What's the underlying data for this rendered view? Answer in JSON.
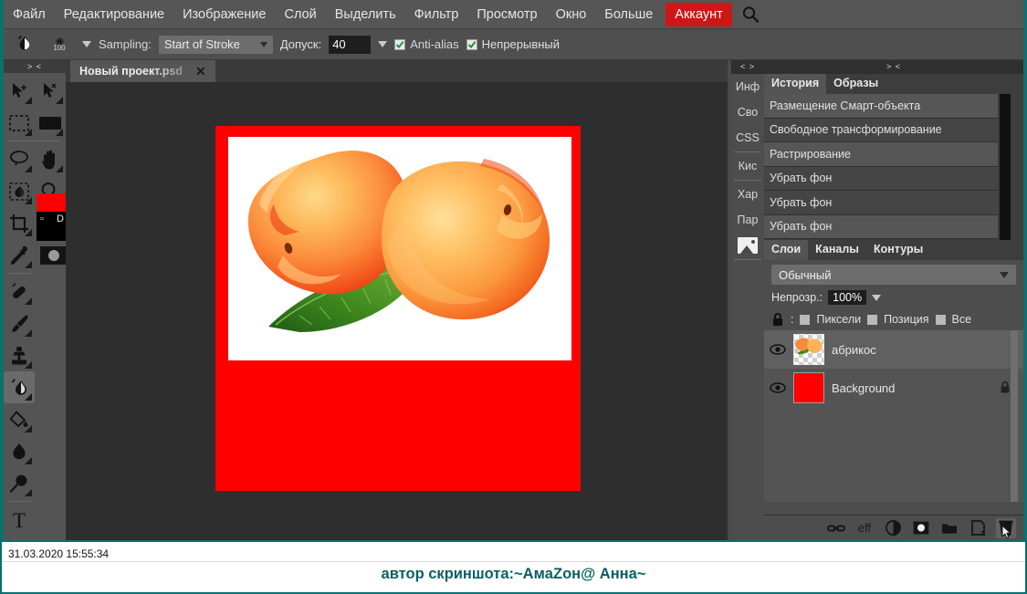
{
  "app": {
    "accent_red": "#cf1717",
    "teal": "#0e6f6f",
    "canvas_red": "#ff0000"
  },
  "menubar": {
    "items": [
      {
        "label": "Файл"
      },
      {
        "label": "Редактирование"
      },
      {
        "label": "Изображение"
      },
      {
        "label": "Слой"
      },
      {
        "label": "Выделить"
      },
      {
        "label": "Фильтр"
      },
      {
        "label": "Просмотр"
      },
      {
        "label": "Окно"
      },
      {
        "label": "Больше"
      }
    ],
    "account_label": "Аккаунт",
    "search_icon": "search-icon"
  },
  "options_bar": {
    "brush_size": "100",
    "sampling_label": "Sampling:",
    "sampling_value": "Start of Stroke",
    "tolerance_label": "Допуск:",
    "tolerance_value": "40",
    "antialias_label": "Anti-alias",
    "antialias_checked": true,
    "contiguous_label": "Непрерывный",
    "contiguous_checked": true
  },
  "toolbar": {
    "grip": "> <",
    "tools": [
      {
        "name": "move-tool",
        "icon": "arrow-move-icon"
      },
      {
        "name": "path-selection-tool",
        "icon": "arrow-path-icon"
      },
      {
        "name": "rectangular-marquee-tool",
        "icon": "marquee-icon"
      },
      {
        "name": "rectangle-shape-tool",
        "icon": "filled-rectangle-icon"
      },
      {
        "name": "lasso-tool",
        "icon": "lasso-icon"
      },
      {
        "name": "hand-tool",
        "icon": "hand-icon"
      },
      {
        "name": "object-select-tool",
        "icon": "object-select-icon"
      },
      {
        "name": "zoom-tool",
        "icon": "magnifier-icon"
      },
      {
        "name": "crop-tool",
        "icon": "crop-icon"
      },
      {
        "name": "eyedropper-tool",
        "icon": "eyedropper-icon"
      },
      {
        "name": "healing-brush-tool",
        "icon": "healing-brush-icon"
      },
      {
        "name": "brush-tool",
        "icon": "brush-icon"
      },
      {
        "name": "clone-stamp-tool",
        "icon": "stamp-icon"
      },
      {
        "name": "background-eraser-tool",
        "icon": "background-eraser-icon"
      },
      {
        "name": "paint-bucket-tool",
        "icon": "paint-bucket-icon"
      },
      {
        "name": "blur-tool",
        "icon": "water-drop-icon"
      },
      {
        "name": "dodge-tool",
        "icon": "dodge-icon"
      },
      {
        "name": "type-tool",
        "icon": "type-t-icon"
      },
      {
        "name": "pen-tool",
        "icon": "pen-icon"
      }
    ],
    "foreground_color": "#ff0000",
    "background_color": "#000000",
    "default_colors_label": "D",
    "quickmask_icon": "quick-mask-icon"
  },
  "document": {
    "tab_title": "Новый проект.psd",
    "close_label": "✕"
  },
  "canvas": {
    "background_color": "#ff0000",
    "photo_background": "#ffffff",
    "content_description": "апельсины-абрикосы",
    "brush_cursor": "brush-cursor"
  },
  "rail": {
    "grip": "< >",
    "items": [
      {
        "label": "Инф",
        "name": "rail-tab-info"
      },
      {
        "label": "Сво",
        "name": "rail-tab-properties"
      },
      {
        "label": "CSS",
        "name": "rail-tab-css"
      },
      {
        "label": "Кис",
        "name": "rail-tab-brushes"
      },
      {
        "label": "Хар",
        "name": "rail-tab-character"
      },
      {
        "label": "Пар",
        "name": "rail-tab-paragraph"
      }
    ],
    "image_icon_name": "image-thumbnail-icon"
  },
  "history_panel": {
    "grip": "> <",
    "tabs": [
      {
        "label": "История",
        "active": true
      },
      {
        "label": "Образы",
        "active": false
      }
    ],
    "items": [
      {
        "label": "Размещение Смарт-объекта",
        "state": "sel"
      },
      {
        "label": "Свободное трансформирование",
        "state": "alt"
      },
      {
        "label": "Растрирование",
        "state": "sel"
      },
      {
        "label": "Убрать фон",
        "state": "alt"
      },
      {
        "label": "Убрать фон",
        "state": "alt"
      },
      {
        "label": "Убрать фон",
        "state": "sel"
      }
    ]
  },
  "layers_panel": {
    "tabs": [
      {
        "label": "Слои",
        "active": true
      },
      {
        "label": "Каналы",
        "active": false
      },
      {
        "label": "Контуры",
        "active": false
      }
    ],
    "blend_mode": "Обычный",
    "opacity_label": "Непрозр.:",
    "opacity_value": "100%",
    "lock_label": ":",
    "lock_options": [
      {
        "label": "Пиксели"
      },
      {
        "label": "Позиция"
      },
      {
        "label": "Все"
      }
    ],
    "layers": [
      {
        "name": "абрикос",
        "selected": true,
        "visible": true,
        "locked": false,
        "thumb": "transparent-apricot"
      },
      {
        "name": "Background",
        "selected": false,
        "visible": true,
        "locked": true,
        "thumb": "red-fill"
      }
    ],
    "bottom_buttons": [
      {
        "name": "link-layers-button",
        "glyph": "link"
      },
      {
        "name": "layer-styles-button",
        "glyph": "eff"
      },
      {
        "name": "adjustment-layer-button",
        "glyph": "half-circle"
      },
      {
        "name": "layer-mask-button",
        "glyph": "mask"
      },
      {
        "name": "new-group-button",
        "glyph": "folder"
      },
      {
        "name": "new-layer-button",
        "glyph": "page"
      },
      {
        "name": "delete-layer-button",
        "glyph": "trash"
      }
    ]
  },
  "status_bar": {
    "timestamp": "31.03.2020 15:55:34",
    "author_caption": "автор скриншота:~AмaZoн@ Анна~"
  }
}
